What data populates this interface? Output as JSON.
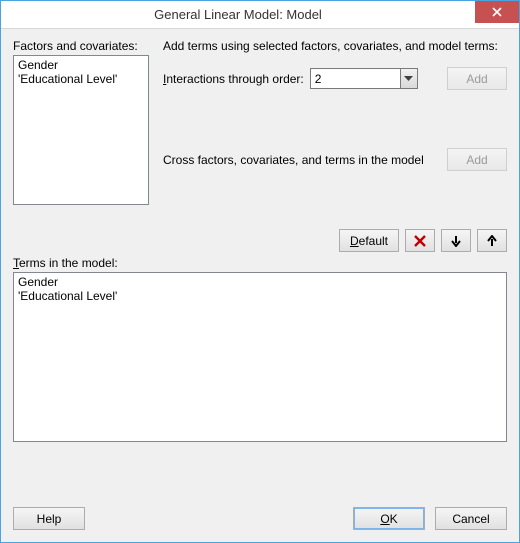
{
  "window": {
    "title": "General Linear Model: Model"
  },
  "factors": {
    "label": "Factors and covariates:",
    "items": [
      "Gender",
      "'Educational Level'"
    ]
  },
  "add_terms": {
    "instruction": "Add terms using selected factors, covariates, and model terms:",
    "interactions_label_pre": "I",
    "interactions_label_post": "nteractions through order:",
    "order_value": "2",
    "add_label": "Add",
    "cross_text": "Cross factors, covariates, and terms in the model",
    "cross_add_label": "Add"
  },
  "toolbar": {
    "default_label_pre": "D",
    "default_label_post": "efault"
  },
  "terms": {
    "label_pre": "T",
    "label_post": "erms in the model:",
    "items": [
      "Gender",
      "'Educational Level'"
    ]
  },
  "buttons": {
    "help": "Help",
    "ok_pre": "O",
    "ok_post": "K",
    "cancel": "Cancel"
  }
}
